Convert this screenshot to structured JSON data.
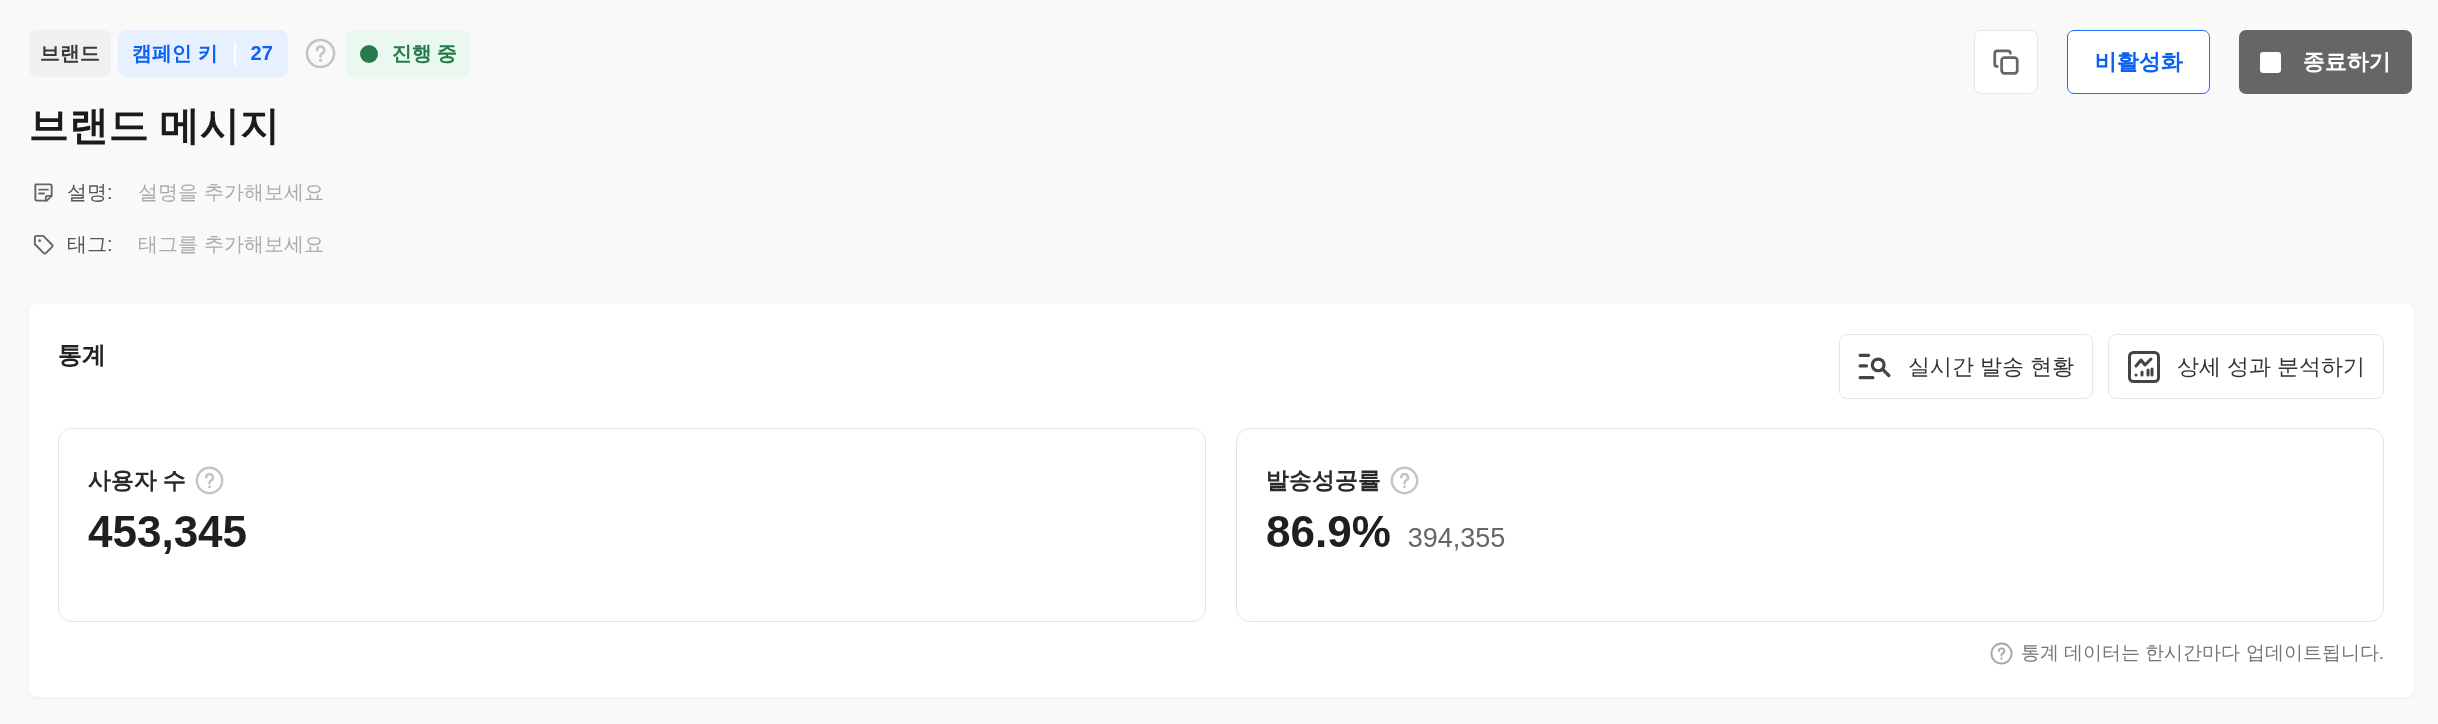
{
  "header": {
    "tags": [
      {
        "kind": "plain",
        "label": "브랜드"
      },
      {
        "kind": "key",
        "label": "캠페인 키",
        "value": "27"
      }
    ],
    "status": {
      "label": "진행 중",
      "color": "#267a4c"
    },
    "title": "브랜드 메시지",
    "fields": [
      {
        "kind": "description",
        "label": "설명:",
        "placeholder": "설명을 추가해보세요"
      },
      {
        "kind": "tags",
        "label": "태그:",
        "placeholder": "태그를 추가해보세요"
      }
    ]
  },
  "actions": [
    {
      "kind": "copy"
    },
    {
      "kind": "outline",
      "label": "비활성화"
    },
    {
      "kind": "stop",
      "label": "종료하기"
    }
  ],
  "stats": {
    "title": "통계",
    "buttons": [
      {
        "kind": "realtime",
        "label": "실시간 발송 현황"
      },
      {
        "kind": "analysis",
        "label": "상세 성과 분석하기"
      }
    ],
    "cards": [
      {
        "label": "사용자 수",
        "value": "453,345"
      },
      {
        "label": "발송성공률",
        "value": "86.9%",
        "sub_value": "394,355"
      }
    ],
    "note": "통계 데이터는 한시간마다 업데이트됩니다."
  }
}
